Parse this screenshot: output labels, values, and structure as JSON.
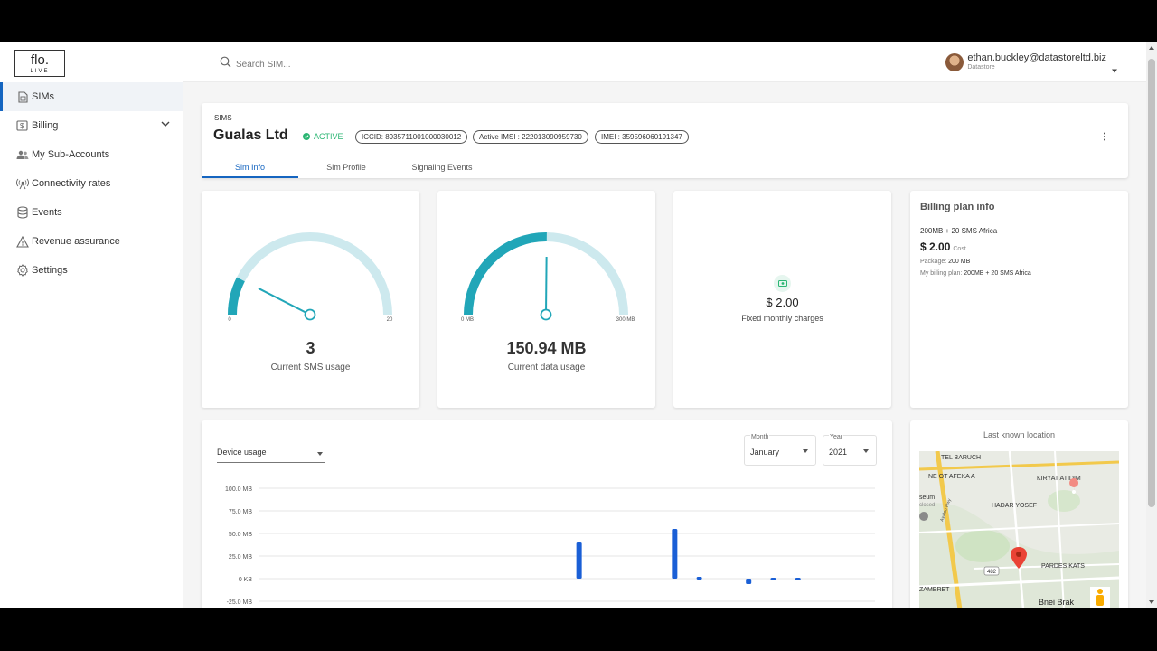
{
  "brand": {
    "logo_text": "flo.",
    "logo_sub": "LIVE"
  },
  "sidebar": {
    "items": [
      {
        "label": "SIMs",
        "icon": "sim-card-icon",
        "active": true
      },
      {
        "label": "Billing",
        "icon": "billing-icon",
        "expandable": true
      },
      {
        "label": "My Sub-Accounts",
        "icon": "people-icon"
      },
      {
        "label": "Connectivity rates",
        "icon": "antenna-icon"
      },
      {
        "label": "Events",
        "icon": "database-icon"
      },
      {
        "label": "Revenue assurance",
        "icon": "warning-icon"
      },
      {
        "label": "Settings",
        "icon": "gear-icon"
      }
    ]
  },
  "header": {
    "search_placeholder": "Search SIM...",
    "user_email": "ethan.buckley@datastoreltd.biz",
    "user_org": "Datastore"
  },
  "sim": {
    "breadcrumb": "SIMS",
    "name": "Gualas Ltd",
    "status": "ACTIVE",
    "iccid": "ICCID: 8935711001000030012",
    "imsi": "Active IMSI : 222013090959730",
    "imei": "IMEI : 359596060191347",
    "tabs": [
      "Sim Info",
      "Sim Profile",
      "Signaling Events"
    ],
    "active_tab": "Sim Info"
  },
  "sms_gauge": {
    "value": 3,
    "min": 0,
    "max": 20,
    "min_label": "0",
    "max_label": "20",
    "value_label": "3",
    "caption": "Current SMS usage"
  },
  "data_gauge": {
    "value": 150.94,
    "min": 0,
    "max": 300,
    "min_label": "0 MB",
    "max_label": "300 MB",
    "value_label": "150.94 MB",
    "caption": "Current data usage"
  },
  "charges": {
    "value": "$ 2.00",
    "caption": "Fixed monthly charges"
  },
  "billing_plan": {
    "title": "Billing plan info",
    "plan": "200MB + 20 SMS Africa",
    "cost": "$ 2.00",
    "cost_label": "Cost",
    "package_label": "Package:",
    "package_value": "200 MB",
    "my_plan_label": "My billing plan:",
    "my_plan_value": "200MB + 20 SMS Africa"
  },
  "usage": {
    "selector": "Device usage",
    "month_label": "Month",
    "month_value": "January",
    "year_label": "Year",
    "year_value": "2021"
  },
  "chart_data": {
    "type": "bar",
    "ylabels": [
      "100.0 MB",
      "75.0 MB",
      "50.0 MB",
      "25.0 MB",
      "0 KB",
      "-25.0 MB"
    ],
    "yvals": [
      100,
      75,
      50,
      25,
      0,
      -25
    ],
    "ylim": [
      -25,
      100
    ],
    "bars": [
      {
        "x": 0.52,
        "value": 40
      },
      {
        "x": 0.675,
        "value": 55
      },
      {
        "x": 0.715,
        "value": 2
      },
      {
        "x": 0.795,
        "value": -6
      },
      {
        "x": 0.835,
        "value": 1
      },
      {
        "x": 0.875,
        "value": 1
      }
    ],
    "color": "#1a5fd6"
  },
  "map": {
    "title": "Last known location",
    "labels": [
      "TEL BARUCH",
      "NE OT AFEKA A",
      "KIRYAT ATIDIM",
      "HADAR YOSEF",
      "seum",
      "closed",
      "PARDES KATS",
      "ZAMERET",
      "Bnei Brak",
      "Ayalon Hwy",
      "482"
    ]
  },
  "colors": {
    "accent": "#1565c0",
    "gauge": "#21a6b8",
    "gauge_track": "#cde9ee",
    "active": "#2bb673"
  }
}
